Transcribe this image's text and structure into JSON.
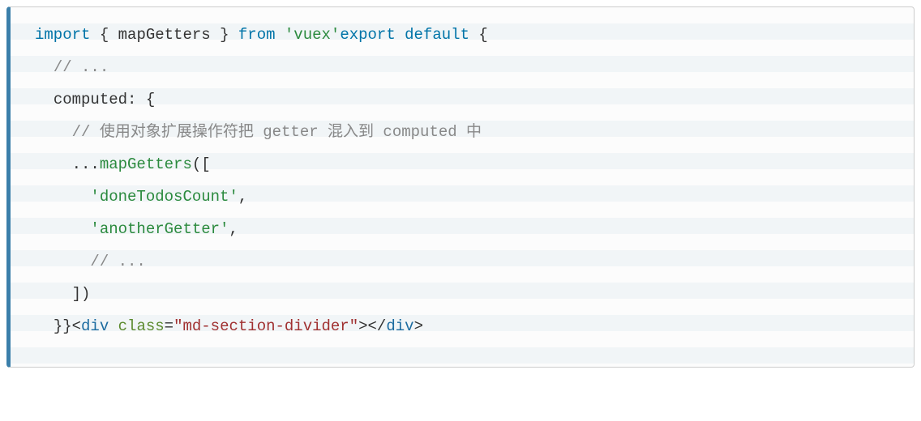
{
  "code": {
    "line1": {
      "kw1": "import",
      "punct1": " { ",
      "id": "mapGetters",
      "punct2": " } ",
      "kw2": "from",
      "sp": " ",
      "str": "'vuex'",
      "kw3": "export",
      "sp2": " ",
      "kw4": "default",
      "punct3": " {"
    },
    "line2": {
      "indent": "  ",
      "cmt": "// ..."
    },
    "line3": {
      "indent": "  ",
      "id": "computed",
      "punct": ": {"
    },
    "line4": {
      "indent": "    ",
      "cmt": "// 使用对象扩展操作符把 getter 混入到 computed 中"
    },
    "line5": {
      "indent": "    ",
      "spread": "...",
      "fn": "mapGetters",
      "punct": "(["
    },
    "line6": {
      "indent": "      ",
      "str": "'doneTodosCount'",
      "punct": ","
    },
    "line7": {
      "indent": "      ",
      "str": "'anotherGetter'",
      "punct": ","
    },
    "line8": {
      "indent": "      ",
      "cmt": "// ..."
    },
    "line9": {
      "indent": "    ",
      "punct": "])"
    },
    "line10": {
      "indent": "  ",
      "punct1": "}}",
      "lt1": "<",
      "tag": "div",
      "sp": " ",
      "attr": "class",
      "eq": "=",
      "val": "\"md-section-divider\"",
      "gt1": ">",
      "lt2": "</",
      "tag2": "div",
      "gt2": ">"
    }
  }
}
